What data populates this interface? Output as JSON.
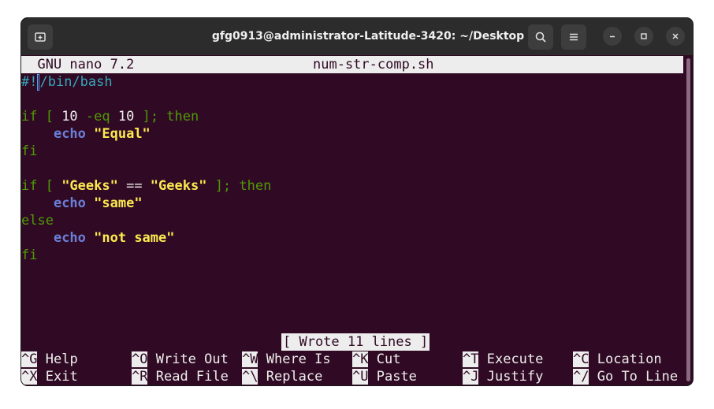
{
  "window": {
    "title": "gfg0913@administrator-Latitude-3420: ~/Desktop"
  },
  "nano": {
    "version": "GNU nano 7.2",
    "filename": "num-str-comp.sh",
    "status": "[ Wrote 11 lines ]"
  },
  "code": {
    "l1_shebang_a": "#!",
    "l1_shebang_b": "/bin/bash",
    "l3_if": "if [ ",
    "l3_num1": "10",
    "l3_op": " -eq ",
    "l3_num2": "10",
    "l3_end": " ]; then",
    "l4_indent": "    ",
    "l4_echo": "echo",
    "l4_str": " \"Equal\"",
    "l5_fi": "fi",
    "l7_if": "if [ ",
    "l7_str1": "\"Geeks\"",
    "l7_op": " == ",
    "l7_str2": "\"Geeks\"",
    "l7_end": " ]; then",
    "l8_echo": "echo",
    "l8_str": " \"same\"",
    "l9_else": "else",
    "l10_echo": "echo",
    "l10_str": " \"not same\"",
    "l11_fi": "fi"
  },
  "shortcuts": [
    {
      "key": "^G",
      "label": "Help"
    },
    {
      "key": "^O",
      "label": "Write Out"
    },
    {
      "key": "^W",
      "label": "Where Is"
    },
    {
      "key": "^K",
      "label": "Cut"
    },
    {
      "key": "^T",
      "label": "Execute"
    },
    {
      "key": "^C",
      "label": "Location"
    },
    {
      "key": "^X",
      "label": "Exit"
    },
    {
      "key": "^R",
      "label": "Read File"
    },
    {
      "key": "^\\",
      "label": "Replace"
    },
    {
      "key": "^U",
      "label": "Paste"
    },
    {
      "key": "^J",
      "label": "Justify"
    },
    {
      "key": "^/",
      "label": "Go To Line"
    }
  ]
}
